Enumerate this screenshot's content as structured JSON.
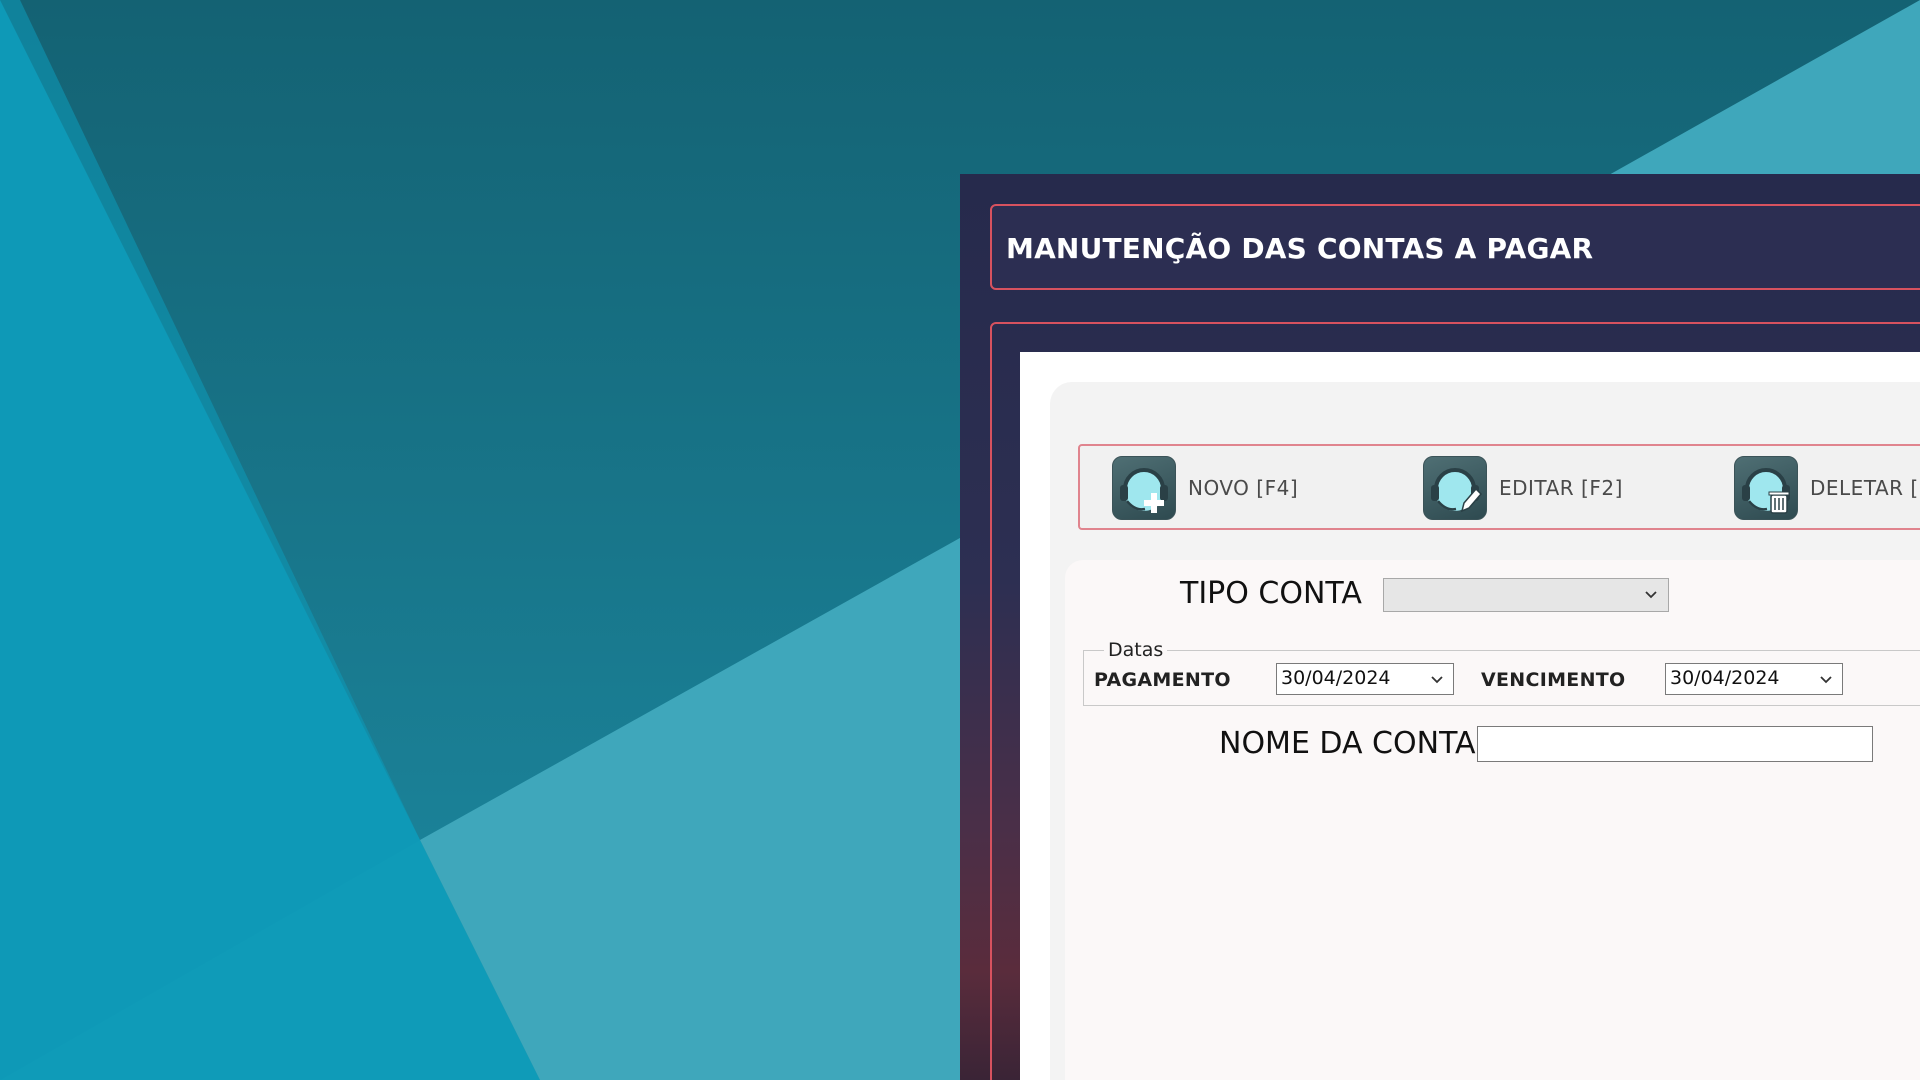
{
  "window": {
    "title": "MANUTENÇÃO DAS CONTAS A PAGAR"
  },
  "toolbar": {
    "buttons": [
      {
        "label": "NOVO [F4]",
        "icon": "headset-add-icon"
      },
      {
        "label": "EDITAR [F2]",
        "icon": "headset-edit-icon"
      },
      {
        "label": "DELETAR [",
        "icon": "headset-delete-icon"
      }
    ]
  },
  "form": {
    "tipo_conta_label": "TIPO CONTA",
    "tipo_conta_value": "",
    "datas_group_label": "Datas",
    "pagamento_label": "PAGAMENTO",
    "pagamento_value": "30/04/2024",
    "vencimento_label": "VENCIMENTO",
    "vencimento_value": "30/04/2024",
    "nome_conta_label": "NOME DA CONTA",
    "nome_conta_value": ""
  },
  "colors": {
    "accent_border": "#d7525f",
    "window_bg": "#2c2e52",
    "desktop_teal": "#1a7f97"
  }
}
